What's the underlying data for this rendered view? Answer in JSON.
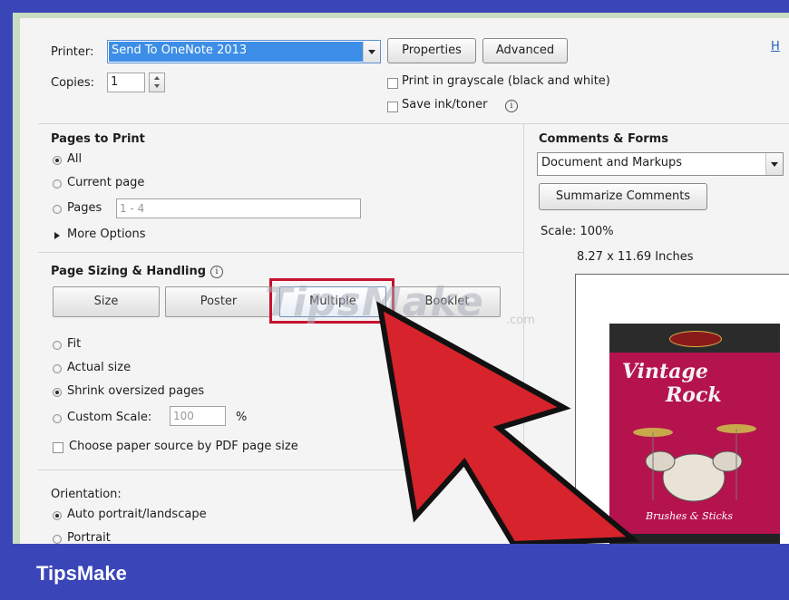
{
  "printer": {
    "label": "Printer:",
    "value": "Send To OneNote 2013",
    "properties_label": "Properties",
    "advanced_label": "Advanced",
    "help_label": "H"
  },
  "copies": {
    "label": "Copies:",
    "value": "1"
  },
  "options": {
    "grayscale_label": "Print in grayscale (black and white)",
    "save_ink_label": "Save ink/toner"
  },
  "pages_to_print": {
    "title": "Pages to Print",
    "all_label": "All",
    "current_label": "Current page",
    "pages_label": "Pages",
    "pages_value": "1 - 4",
    "more_options_label": "More Options"
  },
  "sizing": {
    "title": "Page Sizing & Handling",
    "tabs": [
      "Size",
      "Poster",
      "Multiple",
      "Booklet"
    ],
    "fit_label": "Fit",
    "actual_label": "Actual size",
    "shrink_label": "Shrink oversized pages",
    "custom_label": "Custom Scale:",
    "custom_value": "100",
    "percent": "%",
    "paper_source_label": "Choose paper source by PDF page size"
  },
  "orientation": {
    "title": "Orientation:",
    "auto_label": "Auto portrait/landscape",
    "portrait_label": "Portrait"
  },
  "comments": {
    "title": "Comments & Forms",
    "value": "Document and Markups",
    "summarize_label": "Summarize Comments",
    "scale_label": "Scale: 100%",
    "size_label": "8.27 x 11.69 Inches"
  },
  "preview": {
    "title_line1": "Vintage",
    "title_line2": "Rock",
    "subtitle": "Brushes & Sticks"
  },
  "watermark": {
    "text": "TipsMake",
    "suffix": ".com"
  },
  "banner": {
    "text": "TipsMake"
  },
  "colors": {
    "frame": "#3a46b8",
    "highlight": "#c8102e",
    "arrow": "#d7232b",
    "cover": "#b5134d"
  }
}
